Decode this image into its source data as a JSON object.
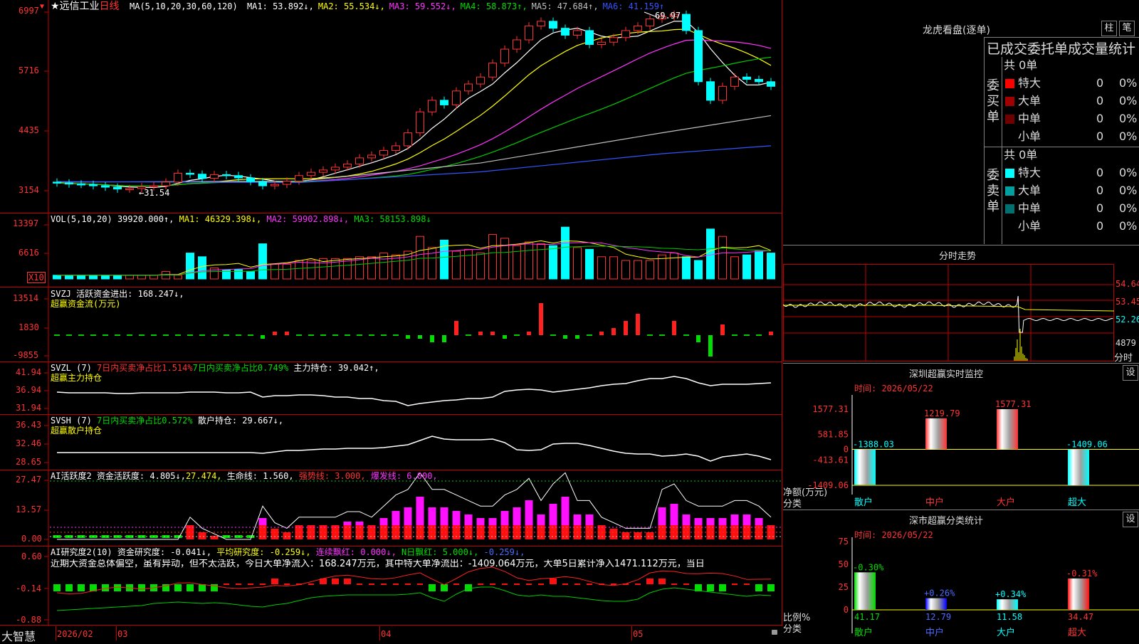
{
  "stock": {
    "name_star": "★",
    "name": "远信工业",
    "period": "日线"
  },
  "ma_legend": {
    "head": "MA(5,10,20,30,60,120)",
    "items": [
      {
        "text": "MA1: 53.892↓,",
        "color": "#ffffff"
      },
      {
        "text": "MA2: 55.534↓,",
        "color": "#ffff00"
      },
      {
        "text": "MA3: 59.552↓,",
        "color": "#ff33ff"
      },
      {
        "text": "MA4: 58.873↑,",
        "color": "#00dd00"
      },
      {
        "text": "MA5: 47.684↑,",
        "color": "#c0c0c0"
      },
      {
        "text": "MA6: 41.159↑",
        "color": "#3355ff"
      }
    ]
  },
  "price_axis": [
    "6997",
    "5716",
    "4435",
    "3154"
  ],
  "price_marks": {
    "high": "69.97",
    "low": "←31.54"
  },
  "vol_legend": {
    "head": "VOL(5,10,20)",
    "value": "39920.000↑,",
    "ma1": "MA1: 46329.398↓,",
    "ma2": "MA2: 59902.898↓,",
    "ma3": "MA3: 58153.898↓"
  },
  "vol_axis": [
    "13397",
    "6616"
  ],
  "vol_unit": "X10",
  "svzj": {
    "head": "SVZJ",
    "label": "活跃资金进出: 168.247↓,",
    "sub": "超赢资金流(万元)",
    "axis": [
      "13514",
      "1830",
      "-9855"
    ]
  },
  "svzl": {
    "head": "SVZL (7)",
    "a": "7日内买卖净占比1.514%",
    "b": "7日内买卖净占比0.749%",
    "c": "主力持仓: 39.042↑,",
    "sub": "超赢主力持仓",
    "axis": [
      "41.94",
      "36.94",
      "31.94"
    ]
  },
  "svsh": {
    "head": "SVSH (7)",
    "a": "7日内买卖净占比0.572%",
    "c": "散户持仓: 29.667↓,",
    "sub": "超赢散户持仓",
    "axis": [
      "36.43",
      "32.46",
      "28.65"
    ]
  },
  "ai1": {
    "head": "AI活跃度2",
    "a": "资金活跃度: 4.805↓,",
    "b": "27.474,",
    "c": "生命线: 1.560,",
    "d": "强势线: 3.000,",
    "e": "爆发线: 6.000,",
    "axis": [
      "27.47",
      "13.57",
      "0.00"
    ]
  },
  "ai2": {
    "head": "AI研究度2(10)",
    "a": "资金研究度: -0.041↓,",
    "b": "平均研究度: -0.259↓,",
    "c": "连续飘红: 0.000↓,",
    "d": "N日飘红: 5.000↓,",
    "e": "-0.259↓,",
    "text": "近期大资金总体偏空，虽有异动，但不太活跃，今日大单净流入：168.247万元，其中特大单净流出：-1409.064万元，大单5日累计净入1471.112万元，当日",
    "axis": [
      "0.60",
      "-0.14",
      "-0.88"
    ]
  },
  "date_axis": {
    "brand": "大智慧",
    "labels": [
      "2026/02",
      "03",
      "04",
      "05"
    ]
  },
  "lhb": {
    "title": "龙虎看盘(逐单)",
    "btn1": "柱",
    "btn2": "笔",
    "tabs": [
      "已成交",
      "委托单",
      "成交量",
      "统计"
    ],
    "buy": {
      "side": "委买单",
      "total": "共 0单",
      "rows": [
        {
          "label": "特大",
          "v": "0",
          "p": "0%",
          "color": "#ff0000"
        },
        {
          "label": "大单",
          "v": "0",
          "p": "0%",
          "color": "#a00000"
        },
        {
          "label": "中单",
          "v": "0",
          "p": "0%",
          "color": "#700000"
        },
        {
          "label": "小单",
          "v": "0",
          "p": "0%",
          "color": ""
        }
      ]
    },
    "sell": {
      "side": "委卖单",
      "total": "共 0单",
      "rows": [
        {
          "label": "特大",
          "v": "0",
          "p": "0%",
          "color": "#00ffff"
        },
        {
          "label": "大单",
          "v": "0",
          "p": "0%",
          "color": "#00a0a0"
        },
        {
          "label": "中单",
          "v": "0",
          "p": "0%",
          "color": "#007070"
        },
        {
          "label": "小单",
          "v": "0",
          "p": "0%",
          "color": ""
        }
      ]
    }
  },
  "fenshi": {
    "title": "分时走势",
    "axis": [
      "54.64",
      "53.45",
      "52.26",
      "4879"
    ],
    "unit": "分时"
  },
  "sz_monitor": {
    "title": "深圳超赢实时监控",
    "btn": "设",
    "time": "时间: 2026/05/22",
    "axis": [
      "1577.31",
      "581.85",
      "0",
      "-413.61",
      "-1409.06"
    ],
    "bars": [
      {
        "cat": "散户",
        "value": -1388.03,
        "label": "-1388.03"
      },
      {
        "cat": "中户",
        "value": 1219.79,
        "label": "1219.79"
      },
      {
        "cat": "大户",
        "value": 1577.31,
        "label": "1577.31"
      },
      {
        "cat": "超大",
        "value": -1409.06,
        "label": "-1409.06"
      }
    ],
    "ylabel": "净额(万元)",
    "xlabel": "分类"
  },
  "sz_class": {
    "title": "深市超赢分类统计",
    "btn": "设",
    "time": "时间: 2026/05/22",
    "axis": [
      "75",
      "50",
      "25",
      "0"
    ],
    "bars": [
      {
        "cat": "散户",
        "value": 41.17,
        "label": "41.17",
        "chg": "-0.30%"
      },
      {
        "cat": "中户",
        "value": 12.79,
        "label": "12.79",
        "chg": "+0.26%"
      },
      {
        "cat": "大户",
        "value": 11.58,
        "label": "11.58",
        "chg": "+0.34%"
      },
      {
        "cat": "超大",
        "value": 34.47,
        "label": "34.47",
        "chg": "-0.31%"
      }
    ],
    "ylabel": "比例%",
    "xlabel": "分类"
  }
}
